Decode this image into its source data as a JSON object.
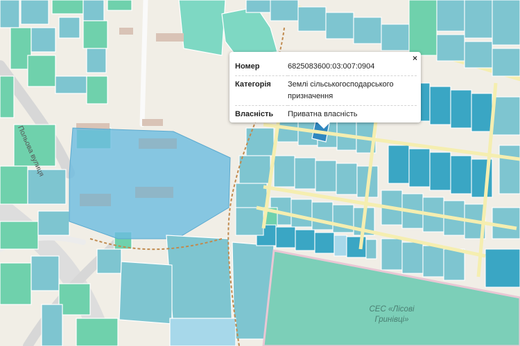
{
  "map": {
    "street_label": "Польова вулиця",
    "area_label_line1": "СЕС «Лісові",
    "area_label_line2": "Гринівці»",
    "colors": {
      "background": "#f1eee6",
      "parcel_agricultural": "#7ec5d0",
      "parcel_dark": "#3aa6c4",
      "parcel_green": "#6fd1ac",
      "selection": "#6cbbe0",
      "road_yellow": "#f5eeb0",
      "road_gray": "#d8d8d8",
      "path_dashed": "#c08a4e"
    }
  },
  "popup": {
    "close_label": "×",
    "rows": [
      {
        "key": "Номер",
        "value": "6825083600:03:007:0904"
      },
      {
        "key": "Категорія",
        "value": "Землі сільськогосподарського призначення"
      },
      {
        "key": "Власність",
        "value": "Приватна власність"
      }
    ]
  }
}
